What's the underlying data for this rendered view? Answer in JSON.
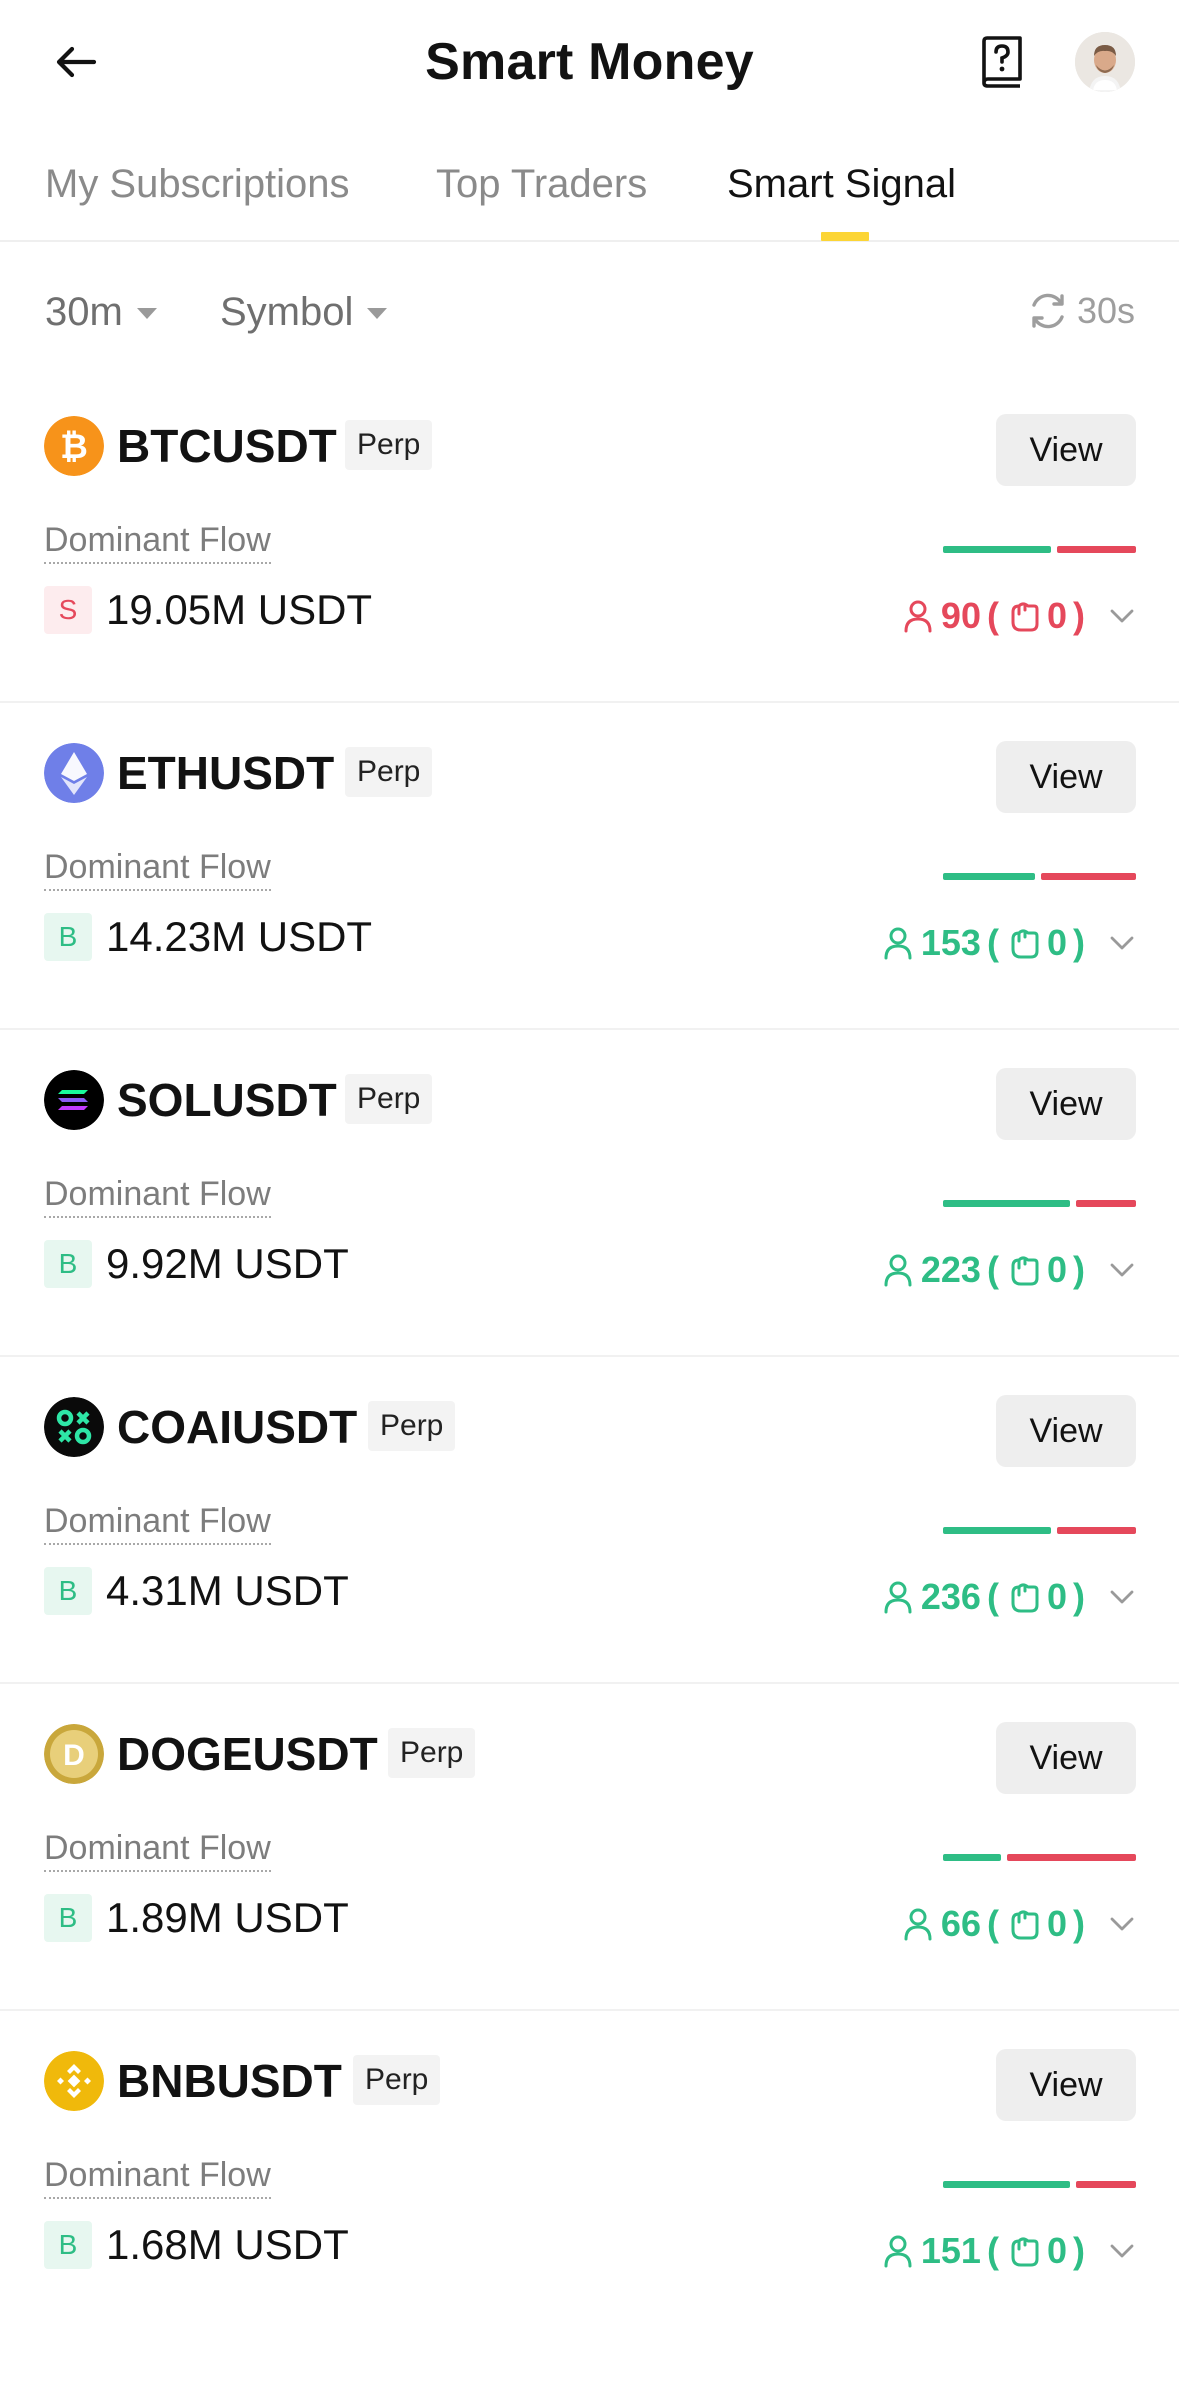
{
  "header": {
    "title": "Smart Money",
    "back_icon": "arrow-left-icon",
    "help_icon": "help-book-icon"
  },
  "tabs": [
    {
      "label": "My Subscriptions",
      "active": false
    },
    {
      "label": "Top Traders",
      "active": false
    },
    {
      "label": "Smart Signal",
      "active": true
    }
  ],
  "filters": {
    "interval": "30m",
    "symbol": "Symbol",
    "refresh": "30s"
  },
  "colors": {
    "buy": "#2ebd85",
    "sell": "#e5485b",
    "accent": "#fcd535"
  },
  "signals": [
    {
      "symbol": "BTCUSDT",
      "badge": "Perp",
      "view_label": "View",
      "flow_label": "Dominant Flow",
      "side": "S",
      "amount": "19.05M USDT",
      "traders": "90",
      "hands": "0",
      "trend": "red",
      "buy_fraction": 0.58,
      "logo": "btc-logo-icon"
    },
    {
      "symbol": "ETHUSDT",
      "badge": "Perp",
      "view_label": "View",
      "flow_label": "Dominant Flow",
      "side": "B",
      "amount": "14.23M USDT",
      "traders": "153",
      "hands": "0",
      "trend": "green",
      "buy_fraction": 0.49,
      "logo": "eth-logo-icon"
    },
    {
      "symbol": "SOLUSDT",
      "badge": "Perp",
      "view_label": "View",
      "flow_label": "Dominant Flow",
      "side": "B",
      "amount": "9.92M USDT",
      "traders": "223",
      "hands": "0",
      "trend": "green",
      "buy_fraction": 0.68,
      "logo": "sol-logo-icon"
    },
    {
      "symbol": "COAIUSDT",
      "badge": "Perp",
      "view_label": "View",
      "flow_label": "Dominant Flow",
      "side": "B",
      "amount": "4.31M USDT",
      "traders": "236",
      "hands": "0",
      "trend": "green",
      "buy_fraction": 0.58,
      "logo": "coai-logo-icon"
    },
    {
      "symbol": "DOGEUSDT",
      "badge": "Perp",
      "view_label": "View",
      "flow_label": "Dominant Flow",
      "side": "B",
      "amount": "1.89M USDT",
      "traders": "66",
      "hands": "0",
      "trend": "green",
      "buy_fraction": 0.31,
      "logo": "doge-logo-icon"
    },
    {
      "symbol": "BNBUSDT",
      "badge": "Perp",
      "view_label": "View",
      "flow_label": "Dominant Flow",
      "side": "B",
      "amount": "1.68M USDT",
      "traders": "151",
      "hands": "0",
      "trend": "green",
      "buy_fraction": 0.68,
      "logo": "bnb-logo-icon"
    }
  ]
}
